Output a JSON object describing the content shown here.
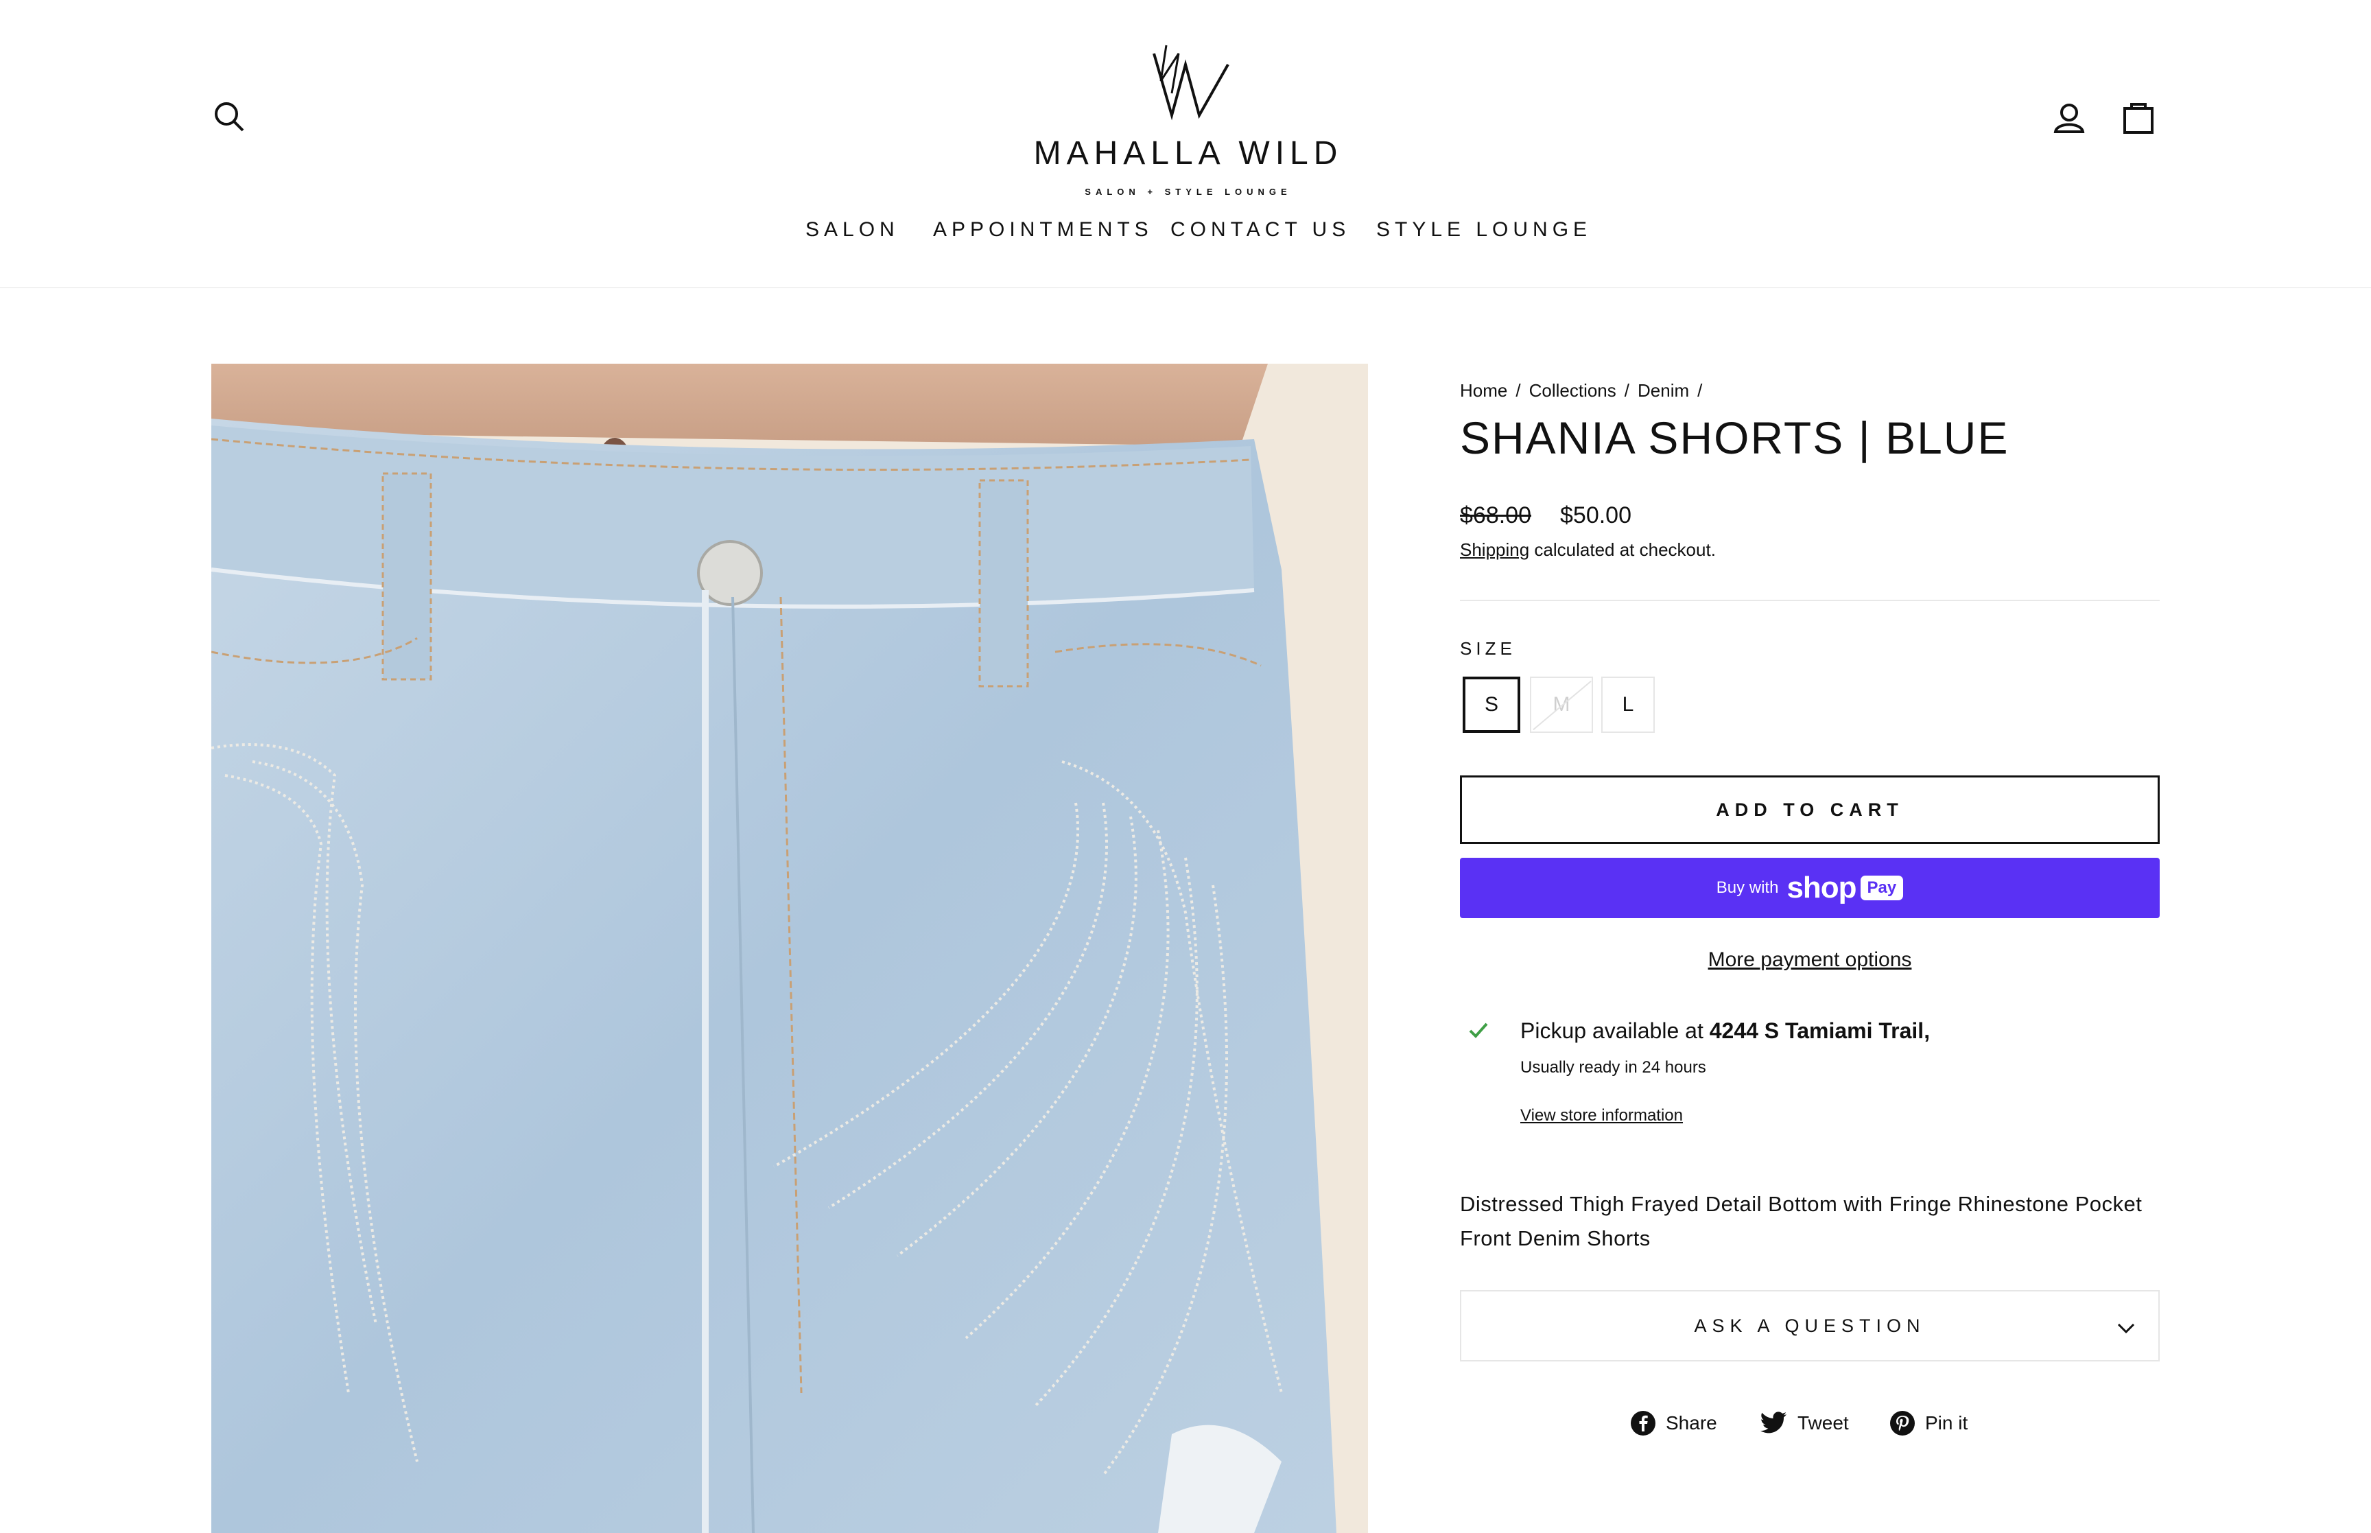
{
  "header": {
    "brand_name": "MAHALLA WILD",
    "brand_tagline": "SALON + STYLE LOUNGE",
    "nav": [
      "SALON",
      "APPOINTMENTS",
      "CONTACT US",
      "STYLE LOUNGE"
    ]
  },
  "breadcrumb": {
    "items": [
      "Home",
      "Collections",
      "Denim"
    ],
    "separator": "/"
  },
  "product": {
    "title": "SHANIA SHORTS | BLUE",
    "price_original": "$68.00",
    "price_sale": "$50.00",
    "shipping_link": "Shipping",
    "shipping_rest": " calculated at checkout.",
    "size_label": "SIZE",
    "sizes": [
      {
        "label": "S",
        "state": "selected"
      },
      {
        "label": "M",
        "state": "unavailable"
      },
      {
        "label": "L",
        "state": "available"
      }
    ],
    "add_to_cart": "ADD TO CART",
    "shoppay": {
      "buy_with": "Buy with",
      "shop": "shop",
      "pay": "Pay"
    },
    "more_payment": "More payment options",
    "pickup": {
      "prefix": "Pickup available at ",
      "location": "4244 S Tamiami Trail,",
      "ready": "Usually ready in 24 hours",
      "store_link": "View store information"
    },
    "description": "Distressed Thigh Frayed Detail Bottom with Fringe Rhinestone Pocket Front Denim Shorts",
    "ask_question": "ASK A QUESTION"
  },
  "social": {
    "share": "Share",
    "tweet": "Tweet",
    "pin": "Pin it"
  },
  "colors": {
    "shoppay_purple": "#5a31f4",
    "check_green": "#3f9f46",
    "text": "#111111"
  },
  "icons": [
    "search-icon",
    "account-icon",
    "cart-icon",
    "check-icon",
    "chevron-down-icon",
    "facebook-icon",
    "twitter-icon",
    "pinterest-icon"
  ]
}
